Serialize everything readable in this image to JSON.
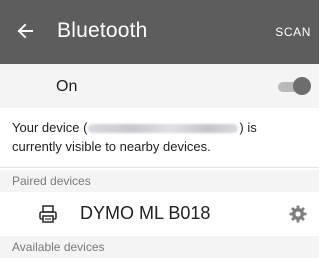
{
  "appbar": {
    "back_icon": "arrow-back-icon",
    "title": "Bluetooth",
    "scan_label": "SCAN",
    "background": "#5d5d5d"
  },
  "toggle": {
    "label": "On",
    "state": true
  },
  "visibility": {
    "prefix": "Your device (",
    "suffix": ") is currently visible to nearby devices."
  },
  "paired": {
    "header": "Paired devices",
    "devices": [
      {
        "name": "DYMO ML B018",
        "icon": "printer-icon",
        "settings_icon": "gear-icon"
      }
    ]
  },
  "available": {
    "header": "Available devices"
  }
}
